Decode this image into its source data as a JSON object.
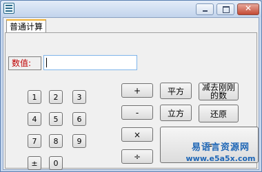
{
  "window": {
    "close_glyph": "✕"
  },
  "tabs": [
    {
      "label": "普通计算"
    }
  ],
  "value": {
    "label": "数值:",
    "input_value": ""
  },
  "keypad": {
    "digits": [
      "1",
      "2",
      "3",
      "4",
      "5",
      "6",
      "7",
      "8",
      "9",
      "±",
      "0"
    ]
  },
  "operators": {
    "add": "+",
    "subtract": "-",
    "multiply": "×",
    "divide": "÷",
    "equals": "="
  },
  "functions": {
    "square": "平方",
    "cube": "立方",
    "subtract_just_now_line1": "减去刚刚",
    "subtract_just_now_line2": "的数",
    "restore": "还原"
  },
  "watermark": {
    "text": "易语言资源网",
    "url": "www.e5a5x.com"
  },
  "colors": {
    "title_bar": "#c2d4ec",
    "label_text": "#c00000",
    "watermark": "#1e66b6",
    "close_button": "#c34a35"
  }
}
